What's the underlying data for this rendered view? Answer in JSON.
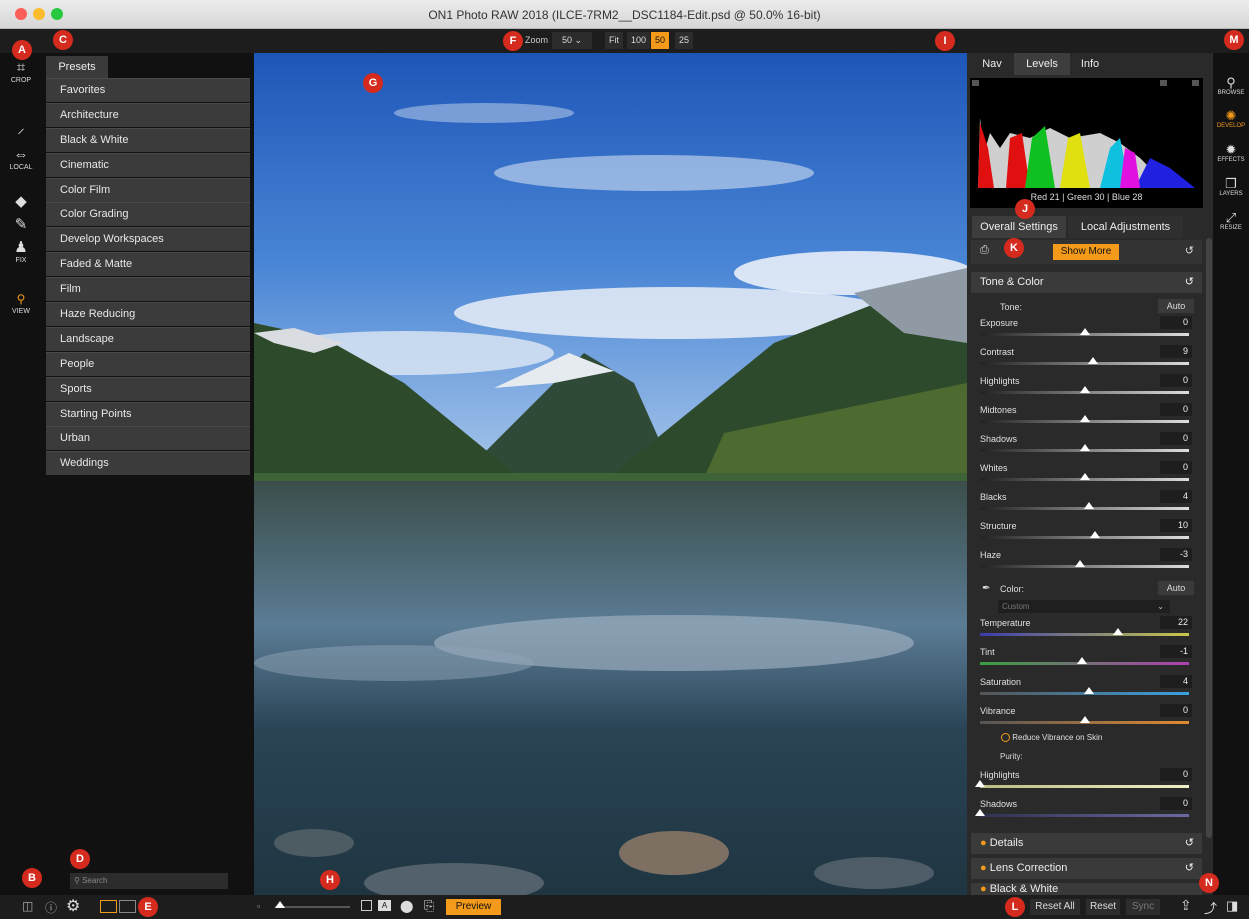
{
  "window": {
    "title": "ON1 Photo RAW 2018 (ILCE-7RM2__DSC1184-Edit.psd @ 50.0% 16-bit)"
  },
  "zoom": {
    "label": "Zoom",
    "value": "50",
    "fit": "Fit",
    "opt100": "100",
    "opt50": "50",
    "opt25": "25"
  },
  "left_tools": [
    {
      "label": "CROP",
      "icon": "crop-icon"
    },
    {
      "label": "",
      "icon": "brush-icon"
    },
    {
      "label": "LOCAL",
      "icon": "gradient-icon"
    },
    {
      "label": "",
      "icon": "eraser-icon"
    },
    {
      "label": "",
      "icon": "bandaid-icon"
    },
    {
      "label": "FIX",
      "icon": "stamp-icon"
    },
    {
      "label": "VIEW",
      "icon": "zoom-icon"
    }
  ],
  "presets": {
    "tab": "Presets",
    "items": [
      "Favorites",
      "Architecture",
      "Black & White",
      "Cinematic",
      "Color Film",
      "Color Grading",
      "Develop Workspaces",
      "Faded & Matte",
      "Film",
      "Haze Reducing",
      "Landscape",
      "People",
      "Sports",
      "Starting Points",
      "Urban",
      "Weddings"
    ],
    "search_placeholder": "Search"
  },
  "right_tabs": {
    "nav": "Nav",
    "levels": "Levels",
    "info": "Info"
  },
  "levels": {
    "red_label": "Red",
    "red": "21",
    "green_label": "Green",
    "green": "30",
    "blue_label": "Blue",
    "blue": "28"
  },
  "settings_tabs": {
    "overall": "Overall Settings",
    "local": "Local Adjustments"
  },
  "show_more": "Show More",
  "tone_color": {
    "title": "Tone & Color",
    "tone_label": "Tone:",
    "auto": "Auto",
    "color_label": "Color:",
    "color_auto": "Auto",
    "color_preset": "Custom",
    "reduce_vibrance": "Reduce Vibrance on Skin",
    "purity_label": "Purity:"
  },
  "sliders": [
    {
      "label": "Exposure",
      "value": "0",
      "pos": 0.5
    },
    {
      "label": "Contrast",
      "value": "9",
      "pos": 0.54
    },
    {
      "label": "Highlights",
      "value": "0",
      "pos": 0.5
    },
    {
      "label": "Midtones",
      "value": "0",
      "pos": 0.5
    },
    {
      "label": "Shadows",
      "value": "0",
      "pos": 0.5
    },
    {
      "label": "Whites",
      "value": "0",
      "pos": 0.5
    },
    {
      "label": "Blacks",
      "value": "4",
      "pos": 0.52
    },
    {
      "label": "Structure",
      "value": "10",
      "pos": 0.55
    },
    {
      "label": "Haze",
      "value": "-3",
      "pos": 0.48
    }
  ],
  "color_sliders": [
    {
      "label": "Temperature",
      "value": "22",
      "pos": 0.66
    },
    {
      "label": "Tint",
      "value": "-1",
      "pos": 0.49
    },
    {
      "label": "Saturation",
      "value": "4",
      "pos": 0.52
    },
    {
      "label": "Vibrance",
      "value": "0",
      "pos": 0.5
    }
  ],
  "purity_sliders": [
    {
      "label": "Highlights",
      "value": "0",
      "pos": 0.0
    },
    {
      "label": "Shadows",
      "value": "0",
      "pos": 0.0
    }
  ],
  "sections": [
    "Details",
    "Lens Correction",
    "Black & White"
  ],
  "right_modules": [
    {
      "label": "BROWSE",
      "icon": "browse-icon"
    },
    {
      "label": "DEVELOP",
      "icon": "develop-icon"
    },
    {
      "label": "EFFECTS",
      "icon": "effects-icon"
    },
    {
      "label": "LAYERS",
      "icon": "layers-icon"
    },
    {
      "label": "RESIZE",
      "icon": "resize-icon"
    }
  ],
  "bottom": {
    "preview": "Preview",
    "reset_all": "Reset All",
    "reset": "Reset",
    "sync": "Sync"
  },
  "callouts": [
    "A",
    "B",
    "C",
    "D",
    "E",
    "F",
    "G",
    "H",
    "I",
    "J",
    "K",
    "L",
    "M",
    "N"
  ],
  "colors": {
    "accent": "#f39a1a",
    "badge": "#d42b1e"
  }
}
